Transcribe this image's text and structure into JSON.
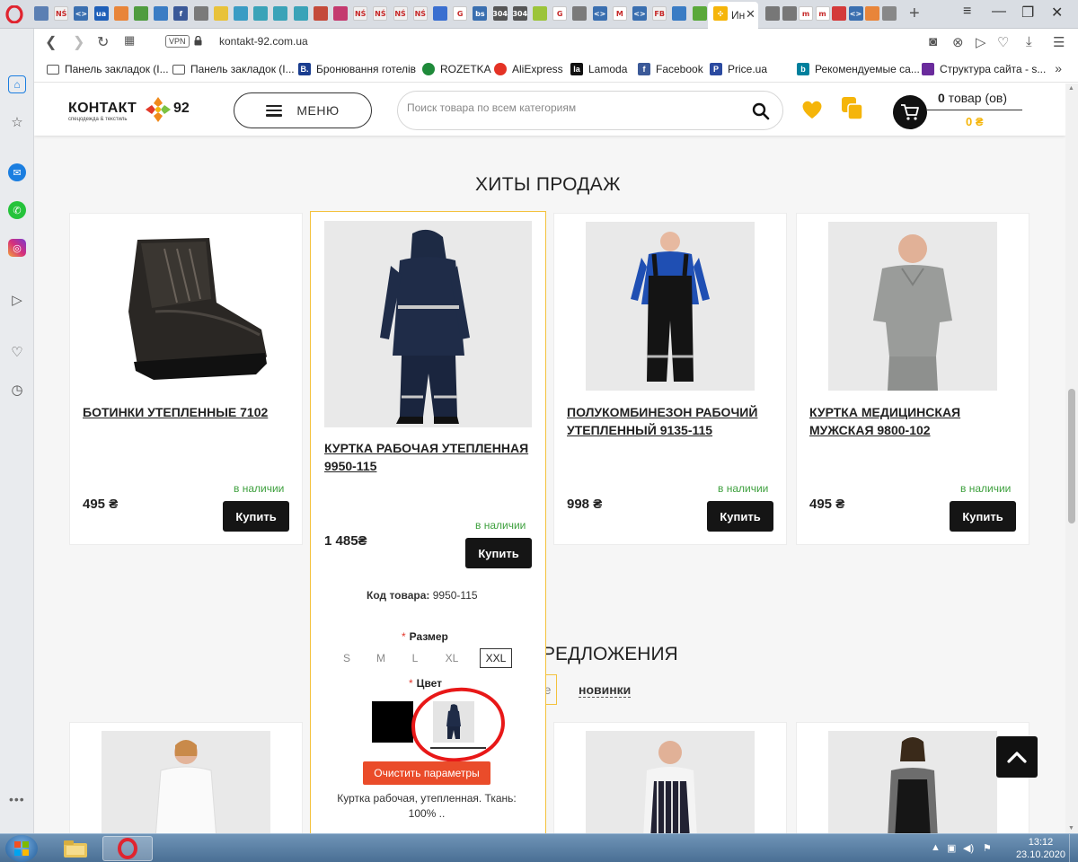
{
  "browser": {
    "active_tab": {
      "title": "Ин",
      "close": "✕"
    },
    "url": "kontakt-92.com.ua",
    "vpn_label": "VPN",
    "bookmarks": [
      {
        "label": "Панель закладок (I...",
        "icon": "folder"
      },
      {
        "label": "Панель закладок (I...",
        "icon": "folder"
      },
      {
        "label": "Бронювання готелів",
        "icon": "booking",
        "icon_text": "B.",
        "color": "#1a3d8f"
      },
      {
        "label": "ROZETKA",
        "icon": "rozetka",
        "color": "#1f8a3a"
      },
      {
        "label": "AliExpress",
        "icon": "aliexpress",
        "color": "#e43225"
      },
      {
        "label": "Lamoda",
        "icon": "lamoda",
        "icon_text": "la",
        "color": "#111111"
      },
      {
        "label": "Facebook",
        "icon": "facebook",
        "icon_text": "f",
        "color": "#3b5998"
      },
      {
        "label": "Price.ua",
        "icon": "price",
        "icon_text": "P",
        "color": "#2b4aa0"
      },
      {
        "label": "Рекомендуемые са...",
        "icon": "bing",
        "icon_text": "b",
        "color": "#00809d"
      },
      {
        "label": "Структура сайта - s...",
        "icon": "structure",
        "color": "#6a2b9c"
      }
    ],
    "bookmarks_more": "»",
    "tab_favicons": [
      {
        "text": "",
        "color": "#5b7fb3"
      },
      {
        "text": "NŚ",
        "color": "#f1f1f1"
      },
      {
        "text": "<>",
        "color": "#3a6fb0"
      },
      {
        "text": "ua",
        "color": "#1e5fb8"
      },
      {
        "text": "",
        "color": "#e8853a"
      },
      {
        "text": "",
        "color": "#4f9c3f"
      },
      {
        "text": "",
        "color": "#3a7cc4"
      },
      {
        "text": "f",
        "color": "#3b5998"
      },
      {
        "text": "",
        "color": "#7a7a7a"
      },
      {
        "text": "",
        "color": "#e8c23a"
      },
      {
        "text": "",
        "color": "#3a9cc4"
      },
      {
        "text": "",
        "color": "#3aa3b8"
      },
      {
        "text": "",
        "color": "#3aa3b8"
      },
      {
        "text": "",
        "color": "#3aa3b8"
      },
      {
        "text": "",
        "color": "#c44a3a"
      },
      {
        "text": "",
        "color": "#c43a6f"
      },
      {
        "text": "NŚ",
        "color": "#f1f1f1"
      },
      {
        "text": "NŚ",
        "color": "#f1f1f1"
      },
      {
        "text": "NŚ",
        "color": "#f1f1f1"
      },
      {
        "text": "NŚ",
        "color": "#f1f1f1"
      },
      {
        "text": "",
        "color": "#3a6fd0"
      },
      {
        "text": "G",
        "color": "#ffffff"
      },
      {
        "text": "bs",
        "color": "#3a6fb0"
      },
      {
        "text": "304",
        "color": "#555555"
      },
      {
        "text": "304",
        "color": "#555555"
      },
      {
        "text": "",
        "color": "#9cc43a"
      },
      {
        "text": "G",
        "color": "#ffffff"
      },
      {
        "text": "",
        "color": "#7a7a7a"
      },
      {
        "text": "<>",
        "color": "#3a6fb0"
      },
      {
        "text": "M",
        "color": "#ffffff"
      },
      {
        "text": "<>",
        "color": "#3a6fb0"
      },
      {
        "text": "FB",
        "color": "#f1f1f1"
      },
      {
        "text": "",
        "color": "#3a7cc4"
      },
      {
        "text": "",
        "color": "#5aa83a"
      }
    ],
    "tab_favicons_right": [
      {
        "text": "",
        "color": "#777777"
      },
      {
        "text": "",
        "color": "#777777"
      },
      {
        "text": "m",
        "color": "#ffffff"
      },
      {
        "text": "m",
        "color": "#ffffff"
      },
      {
        "text": "",
        "color": "#d43a3a"
      },
      {
        "text": "<>",
        "color": "#3a6fb0"
      },
      {
        "text": "",
        "color": "#e8853a"
      },
      {
        "text": "",
        "color": "#888888"
      }
    ]
  },
  "site": {
    "logo_text": "КОНТАКТ",
    "logo_number": "92",
    "logo_sub": "спецодежда & текстиль",
    "menu_label": "МЕНЮ",
    "search_placeholder": "Поиск товара по всем категориям",
    "cart_count": "0",
    "cart_count_label": " товар (ов)",
    "cart_sum": "0 ₴",
    "accent_color": "#f5b50a"
  },
  "bestsellers": {
    "title": "ХИТЫ ПРОДАЖ",
    "products": [
      {
        "name": "БОТИНКИ УТЕПЛЕННЫЕ 7102",
        "price": "495 ₴",
        "stock": "в наличии",
        "buy": "Купить"
      },
      {
        "name": "КУРТКА РАБОЧАЯ УТЕПЛЕННАЯ 9950-115",
        "price": "1 485₴",
        "stock": "в наличии",
        "buy": "Купить",
        "code_label": "Код товара:",
        "code": "9950-115",
        "size_label": "Размер",
        "sizes": [
          "S",
          "M",
          "L",
          "XL",
          "XXL"
        ],
        "selected_size": "XXL",
        "color_label": "Цвет",
        "clear_label": "Очистить параметры",
        "description": "Куртка рабочая, утепленная. Ткань: 100% .."
      },
      {
        "name": "ПОЛУКОМБИНЕЗОН РАБОЧИЙ УТЕПЛЕННЫЙ 9135-115",
        "price": "998 ₴",
        "stock": "в наличии",
        "buy": "Купить"
      },
      {
        "name": "КУРТКА МЕДИЦИНСКАЯ МУЖСКАЯ 9800-102",
        "price": "495 ₴",
        "stock": "в наличии",
        "buy": "Купить"
      }
    ]
  },
  "offers": {
    "title_fragment": "РЕДЛОЖЕНИЯ",
    "tab_fragment": "е",
    "tab_new": "новинки"
  },
  "taskbar": {
    "time": "13:12",
    "date": "23.10.2020"
  }
}
